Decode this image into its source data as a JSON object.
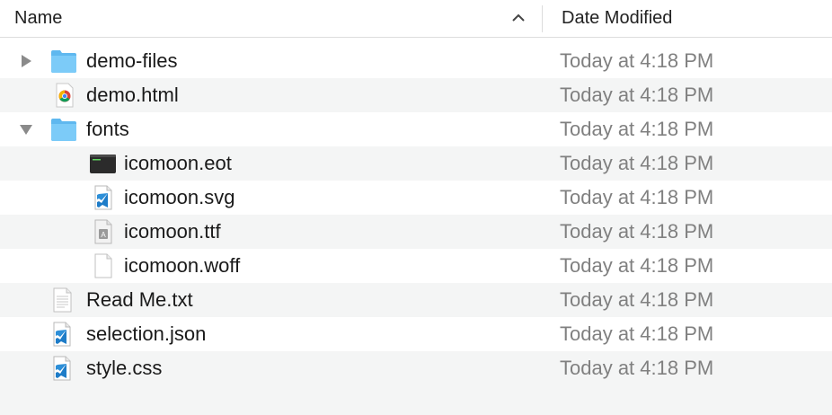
{
  "header": {
    "name_label": "Name",
    "date_label": "Date Modified",
    "sort_icon": "chevron-up-icon"
  },
  "files": [
    {
      "name": "demo-files",
      "date": "Today at 4:18 PM",
      "icon": "folder-icon",
      "disclosure": "collapsed"
    },
    {
      "name": "demo.html",
      "date": "Today at 4:18 PM",
      "icon": "chrome-html-file-icon",
      "disclosure": "none"
    },
    {
      "name": "fonts",
      "date": "Today at 4:18 PM",
      "icon": "folder-icon",
      "disclosure": "expanded"
    },
    {
      "name": "icomoon.eot",
      "date": "Today at 4:18 PM",
      "icon": "terminal-file-icon",
      "disclosure": "none"
    },
    {
      "name": "icomoon.svg",
      "date": "Today at 4:18 PM",
      "icon": "vscode-file-icon",
      "disclosure": "none"
    },
    {
      "name": "icomoon.ttf",
      "date": "Today at 4:18 PM",
      "icon": "font-file-icon",
      "disclosure": "none"
    },
    {
      "name": "icomoon.woff",
      "date": "Today at 4:18 PM",
      "icon": "blank-file-icon",
      "disclosure": "none"
    },
    {
      "name": "Read Me.txt",
      "date": "Today at 4:18 PM",
      "icon": "text-file-icon",
      "disclosure": "none"
    },
    {
      "name": "selection.json",
      "date": "Today at 4:18 PM",
      "icon": "vscode-file-icon",
      "disclosure": "none"
    },
    {
      "name": "style.css",
      "date": "Today at 4:18 PM",
      "icon": "vscode-file-icon",
      "disclosure": "none"
    }
  ],
  "colors": {
    "folder": "#6cc3f5",
    "row_alt": "#f4f5f5",
    "date_text": "#808080",
    "vscode_blue": "#1e7cc8"
  }
}
